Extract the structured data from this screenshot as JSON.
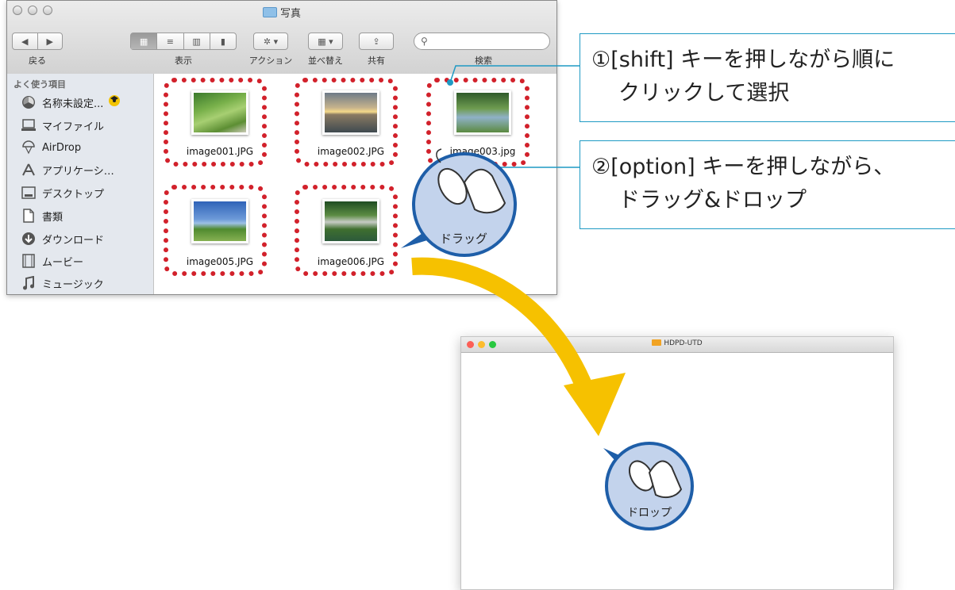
{
  "finder": {
    "title": "写真",
    "toolbar": {
      "back_label": "戻る",
      "view_label": "表示",
      "action_label": "アクション",
      "arrange_label": "並べ替え",
      "share_label": "共有",
      "search_label": "検索"
    },
    "sidebar": {
      "header": "よく使う項目",
      "items": [
        {
          "label": "名称未設定...",
          "icon": "disk-icon"
        },
        {
          "label": "マイファイル",
          "icon": "all-files-icon"
        },
        {
          "label": "AirDrop",
          "icon": "airdrop-icon"
        },
        {
          "label": "アプリケーシ…",
          "icon": "applications-icon"
        },
        {
          "label": "デスクトップ",
          "icon": "desktop-icon"
        },
        {
          "label": "書類",
          "icon": "documents-icon"
        },
        {
          "label": "ダウンロード",
          "icon": "downloads-icon"
        },
        {
          "label": "ムービー",
          "icon": "movies-icon"
        },
        {
          "label": "ミュージック",
          "icon": "music-icon"
        }
      ]
    },
    "files": [
      {
        "name": "image001.JPG",
        "selected": true
      },
      {
        "name": "image002.JPG",
        "selected": true
      },
      {
        "name": "image003.jpg",
        "selected": true
      },
      {
        "name": "image005.JPG",
        "selected": true
      },
      {
        "name": "image006.JPG",
        "selected": true
      }
    ]
  },
  "callouts": [
    {
      "num": "①",
      "line1": "[shift] キーを押しながら順に",
      "line2": "クリックして選択"
    },
    {
      "num": "②",
      "line1": "[option] キーを押しながら、",
      "line2": "ドラッグ&ドロップ"
    }
  ],
  "bubbles": {
    "drag": "ドラッグ",
    "drop": "ドロップ"
  },
  "drive_window": {
    "title": "HDPD-UTD"
  },
  "colors": {
    "selection_dots": "#d2212b",
    "arrow": "#f6c100",
    "callout_border": "#1f9ac4",
    "bubble_fill": "#c3d3ec",
    "bubble_border": "#1e5ea8"
  }
}
